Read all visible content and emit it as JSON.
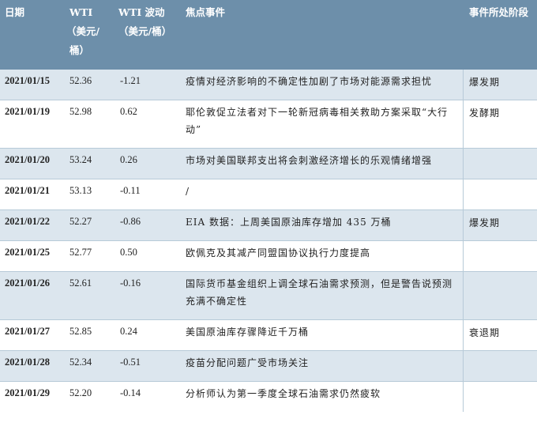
{
  "headers": {
    "date": "日期",
    "wti_line1": "WTI",
    "wti_line2": "（美元/",
    "wti_line3": "桶）",
    "chg_line1": "WTI 波动",
    "chg_line2": "（美元/桶）",
    "event": "焦点事件",
    "stage": "事件所处阶段"
  },
  "rows": [
    {
      "date": "2021/01/15",
      "wti": "52.36",
      "change": "-1.21",
      "event": "疫情对经济影响的不确定性加剧了市场对能源需求担忧",
      "stage": "爆发期"
    },
    {
      "date": "2021/01/19",
      "wti": "52.98",
      "change": "0.62",
      "event": "耶伦敦促立法者对下一轮新冠病毒相关救助方案采取“大行动”",
      "stage": "发酵期"
    },
    {
      "date": "2021/01/20",
      "wti": "53.24",
      "change": "0.26",
      "event": "市场对美国联邦支出将会刺激经济增长的乐观情绪增强",
      "stage": ""
    },
    {
      "date": "2021/01/21",
      "wti": "53.13",
      "change": "-0.11",
      "event": "/",
      "stage": ""
    },
    {
      "date": "2021/01/22",
      "wti": "52.27",
      "change": "-0.86",
      "event": "EIA 数据：上周美国原油库存增加 435 万桶",
      "stage": "爆发期"
    },
    {
      "date": "2021/01/25",
      "wti": "52.77",
      "change": "0.50",
      "event": "欧佩克及其减产同盟国协议执行力度提高",
      "stage": ""
    },
    {
      "date": "2021/01/26",
      "wti": "52.61",
      "change": "-0.16",
      "event": "国际货币基金组织上调全球石油需求预测，但是警告说预测充满不确定性",
      "stage": ""
    },
    {
      "date": "2021/01/27",
      "wti": "52.85",
      "change": "0.24",
      "event": "美国原油库存骤降近千万桶",
      "stage": "衰退期"
    },
    {
      "date": "2021/01/28",
      "wti": "52.34",
      "change": "-0.51",
      "event": "疫苗分配问题广受市场关注",
      "stage": ""
    },
    {
      "date": "2021/01/29",
      "wti": "52.20",
      "change": "-0.14",
      "event": "分析师认为第一季度全球石油需求仍然疲软",
      "stage": ""
    }
  ]
}
